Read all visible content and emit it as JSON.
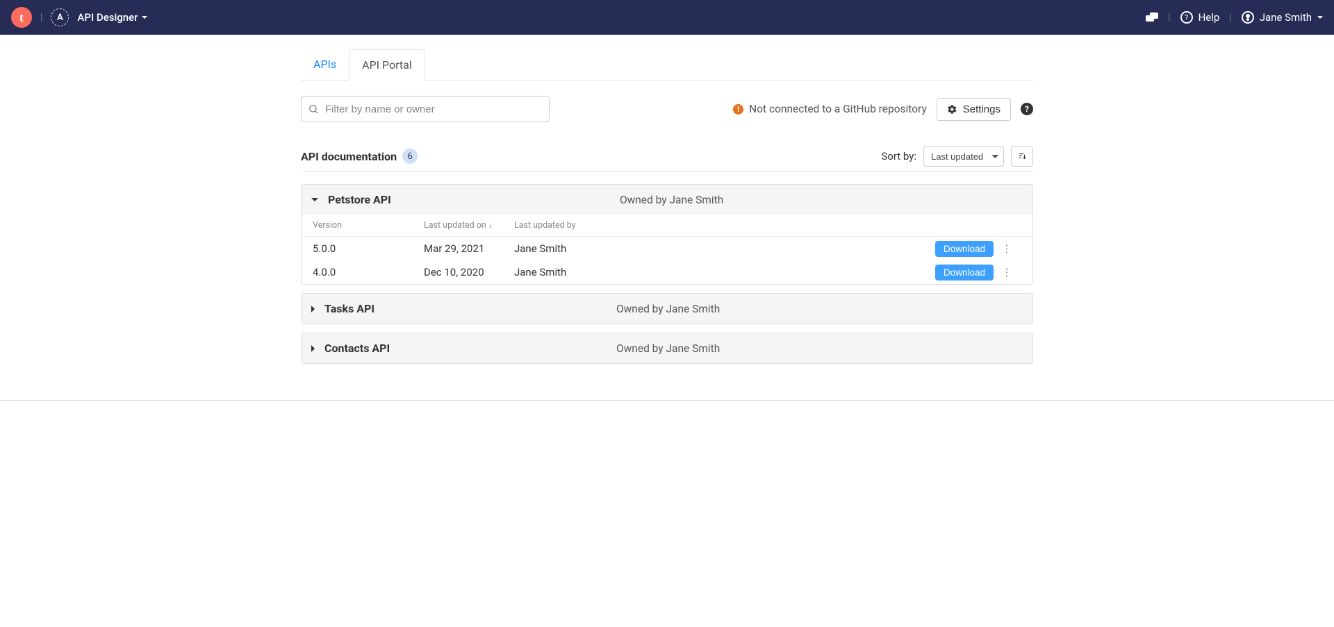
{
  "topbar": {
    "logo_letter": "t",
    "secondary_logo_letter": "A",
    "app_name": "API Designer",
    "help_label": "Help",
    "user_name": "Jane Smith"
  },
  "tabs": [
    {
      "label": "APIs"
    },
    {
      "label": "API Portal"
    }
  ],
  "search": {
    "placeholder": "Filter by name or owner"
  },
  "github_status": "Not connected to a GitHub repository",
  "settings_label": "Settings",
  "section": {
    "title": "API documentation",
    "count": "6",
    "sort_label": "Sort by:",
    "sort_value": "Last updated"
  },
  "version_table": {
    "col_version": "Version",
    "col_updated_on": "Last updated on ↓",
    "col_updated_by": "Last updated by",
    "download_label": "Download"
  },
  "apis": [
    {
      "name": "Petstore API",
      "owner": "Owned by Jane Smith",
      "expanded": true,
      "versions": [
        {
          "version": "5.0.0",
          "updated_on": "Mar 29, 2021",
          "updated_by": "Jane Smith"
        },
        {
          "version": "4.0.0",
          "updated_on": "Dec 10, 2020",
          "updated_by": "Jane Smith"
        }
      ]
    },
    {
      "name": "Tasks API",
      "owner": "Owned by Jane Smith",
      "expanded": false,
      "versions": []
    },
    {
      "name": "Contacts API",
      "owner": "Owned by Jane Smith",
      "expanded": false,
      "versions": []
    }
  ]
}
